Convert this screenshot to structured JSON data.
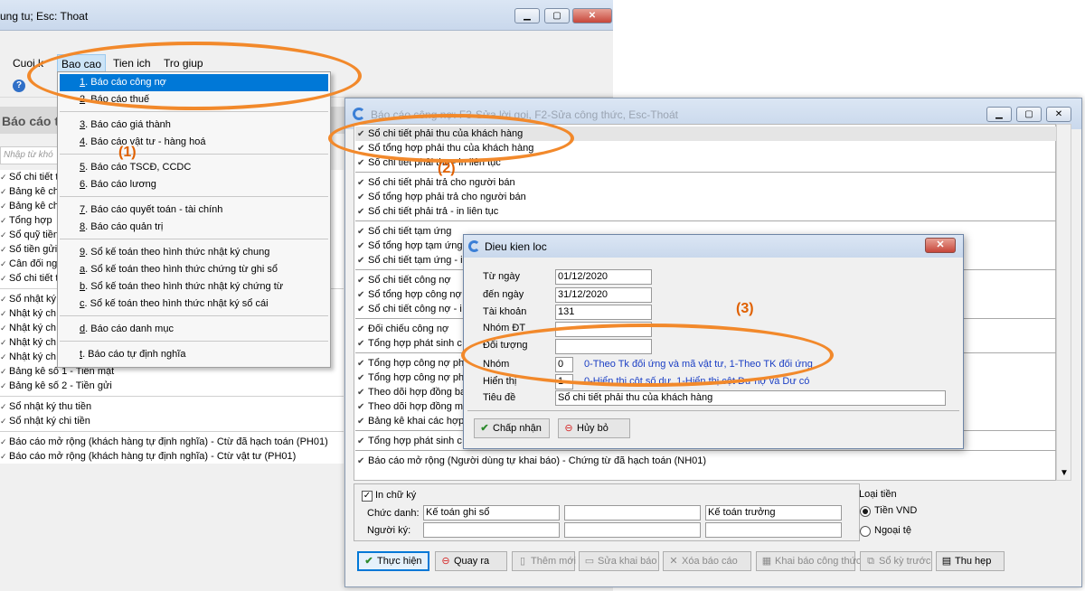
{
  "main_window": {
    "title": "ung tu; Esc: Thoat",
    "menu": [
      "Cuoi k",
      "Bao cao",
      "Tien ich",
      "Tro giup"
    ],
    "section_header": "Báo cáo t",
    "filter_placeholder": "Nhập từ khó",
    "list": [
      {
        "label": "Sổ chi tiết t"
      },
      {
        "label": "Bảng kê ch"
      },
      {
        "label": "Bảng kê ch"
      },
      {
        "label": "Tổng hợp"
      },
      {
        "label": "Sổ quỹ tiền"
      },
      {
        "label": "Sổ tiền gửi"
      },
      {
        "label": "Cân đối ng"
      },
      {
        "label": "Sổ chi tiết t",
        "sep_after": true
      },
      {
        "label": "Sổ nhật ký"
      },
      {
        "label": "Nhật ký ch"
      },
      {
        "label": "Nhật ký ch"
      },
      {
        "label": "Nhật ký ch"
      },
      {
        "label": "Nhật ký ch"
      },
      {
        "label": "Bảng kê số 1 - Tiền mặt"
      },
      {
        "label": "Bảng kê số 2 - Tiền gửi",
        "sep_after": true
      },
      {
        "label": "Sổ nhật ký thu tiền"
      },
      {
        "label": "Sổ nhật ký chi tiền",
        "sep_after": true
      },
      {
        "label": "Báo cáo mở rộng (khách hàng tự định nghĩa) - Ctừ đã hạch toán (PH01)"
      },
      {
        "label": "Báo cáo mở rộng (khách hàng tự định nghĩa) - Ctừ vật tư (PH01)"
      }
    ]
  },
  "dropdown": {
    "items": [
      {
        "key": "1",
        "label": ". Báo cáo công nợ"
      },
      {
        "key": "2",
        "label": ". Báo cáo thuế"
      },
      {
        "key": "3",
        "label": ". Báo cáo giá thành"
      },
      {
        "key": "4",
        "label": ". Báo cáo vật tư - hàng hoá"
      },
      {
        "key": "5",
        "label": ". Báo cáo TSCĐ, CCDC"
      },
      {
        "key": "6",
        "label": ". Báo cáo lương"
      },
      {
        "key": "7",
        "label": ". Báo cáo quyết toán - tài chính"
      },
      {
        "key": "8",
        "label": ". Báo cáo quản trị"
      },
      {
        "key": "9",
        "label": ". Sổ kế toán theo hình thức nhật ký chung"
      },
      {
        "key": "a",
        "label": ". Sổ kế toán theo hình thức chứng từ ghi sổ"
      },
      {
        "key": "b",
        "label": ". Sổ kế toán theo hình thức nhật ký chứng từ"
      },
      {
        "key": "c",
        "label": ". Sổ kế toán theo hình thức nhật ký sổ cái"
      },
      {
        "key": "d",
        "label": ". Báo cáo danh mục"
      },
      {
        "key": "t",
        "label": ". Báo cáo tự định nghĩa"
      }
    ]
  },
  "report_window": {
    "title": "Báo cáo công nợ: F3-Sửa lời gọi, F2-Sửa công thức, Esc-Thoát",
    "rows": [
      "Sổ chi tiết phải thu của khách hàng",
      "Sổ tổng hợp phải thu của khách hàng",
      "Sổ chi tiết phải thu - in liên tục",
      "Sổ chi tiết phải trả cho người bán",
      "Sổ tổng hợp phải trả cho người bán",
      "Sổ chi tiết phải trả - in liên tục",
      "Sổ chi tiết tạm ứng",
      "Sổ tổng hợp tạm ứng",
      "Sổ chi tiết tạm ứng - i",
      "Sổ chi tiết công nợ",
      "Sổ tổng hợp công nợ",
      "Sổ chi tiết công nợ - i",
      "Đối chiếu công nợ",
      "Tổng hợp phát sinh c",
      "Tổng hợp công nợ ph",
      "Tổng hợp công nợ ph",
      "Theo dõi hợp đồng ba",
      "Theo dõi hợp đồng m",
      "Bảng kê khai các hợp",
      "Tổng hợp phát sinh c",
      "Báo cáo mở rộng (Người dùng tự khai báo) - Chứng từ đã hạch toán (NH01)"
    ],
    "sign": {
      "check_label": "In chữ ký",
      "title_label": "Chức danh:",
      "signer_label": "Người ký:",
      "title_values": [
        "Kế toán ghi sổ",
        "",
        "Kế toán trưởng"
      ],
      "signer_values": [
        "",
        "",
        ""
      ]
    },
    "currency": {
      "title": "Loại tiền",
      "options": [
        "Tiền VND",
        "Ngoại tệ"
      ],
      "selected": "Tiền VND"
    },
    "buttons": [
      {
        "label": "Thực hiện",
        "icon": "✔"
      },
      {
        "label": "Quay ra",
        "icon": "⊖"
      },
      {
        "label": "Thêm mới",
        "icon": "▯"
      },
      {
        "label": "Sửa khai báo",
        "icon": "▭"
      },
      {
        "label": "Xóa báo cáo",
        "icon": "✕"
      },
      {
        "label": "Khai báo công thức",
        "icon": "▦"
      },
      {
        "label": "Sổ kỳ trước",
        "icon": "⧉"
      },
      {
        "label": "Thu hẹp",
        "icon": "▤"
      }
    ]
  },
  "filter_dialog": {
    "title": "Dieu kien loc",
    "fields": [
      {
        "label": "Từ ngày",
        "value": "01/12/2020"
      },
      {
        "label": "đến ngày",
        "value": "31/12/2020"
      },
      {
        "label": "Tài khoản",
        "value": "131"
      },
      {
        "label": "Nhóm ĐT",
        "value": ""
      },
      {
        "label": "Đối tượng",
        "value": ""
      }
    ],
    "group": {
      "label": "Nhóm",
      "value": "0",
      "hint": "0-Theo Tk đối ứng và mã vật tư, 1-Theo TK đối ứng"
    },
    "display": {
      "label": "Hiển thị",
      "value": "1",
      "hint": "0-Hiển thị cột số dư, 1-Hiển thị cột Dư nợ và Dư có"
    },
    "caption": {
      "label": "Tiêu đề",
      "value": "Sổ chi tiết phải thu của khách hàng"
    },
    "ok_label": "Chấp nhận",
    "cancel_label": "Hủy bỏ"
  },
  "annotations": [
    "(1)",
    "(2)",
    "(3)"
  ],
  "colors": {
    "annotation": "#f2892b",
    "highlight": "#0078d7",
    "hint_text": "#1a3ec4"
  }
}
